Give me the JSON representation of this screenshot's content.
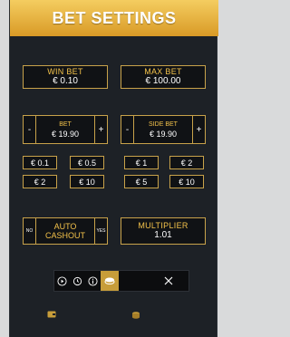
{
  "header": {
    "title": "BET SETTINGS"
  },
  "win_bet": {
    "label": "WIN BET",
    "value": "€ 0.10"
  },
  "max_bet": {
    "label": "MAX BET",
    "value": "€ 100.00"
  },
  "bet_stepper": {
    "minus": "-",
    "label": "BET",
    "value": "€ 19.90",
    "plus": "+"
  },
  "side_bet_stepper": {
    "minus": "-",
    "label": "SIDE BET",
    "value": "€ 19.90",
    "plus": "+"
  },
  "bet_chips": [
    "€ 0.1",
    "€ 0.5",
    "€ 2",
    "€ 10"
  ],
  "side_bet_chips": [
    "€ 1",
    "€ 2",
    "€ 5",
    "€ 10"
  ],
  "auto_cashout": {
    "no": "NO",
    "label_line1": "AUTO",
    "label_line2": "CASHOUT",
    "yes": "YES"
  },
  "multiplier": {
    "label": "MULTIPLIER",
    "value": "1.01"
  },
  "toolbar": {
    "icons": [
      "play-icon",
      "history-icon",
      "info-icon",
      "chip-stack-icon",
      "close-icon"
    ],
    "active": "chip-stack-icon"
  },
  "colors": {
    "accent": "#f3c24a",
    "border": "#c8a24a",
    "panel": "#1d2126",
    "header_top": "#f4cd60",
    "header_bottom": "#d99a26"
  }
}
